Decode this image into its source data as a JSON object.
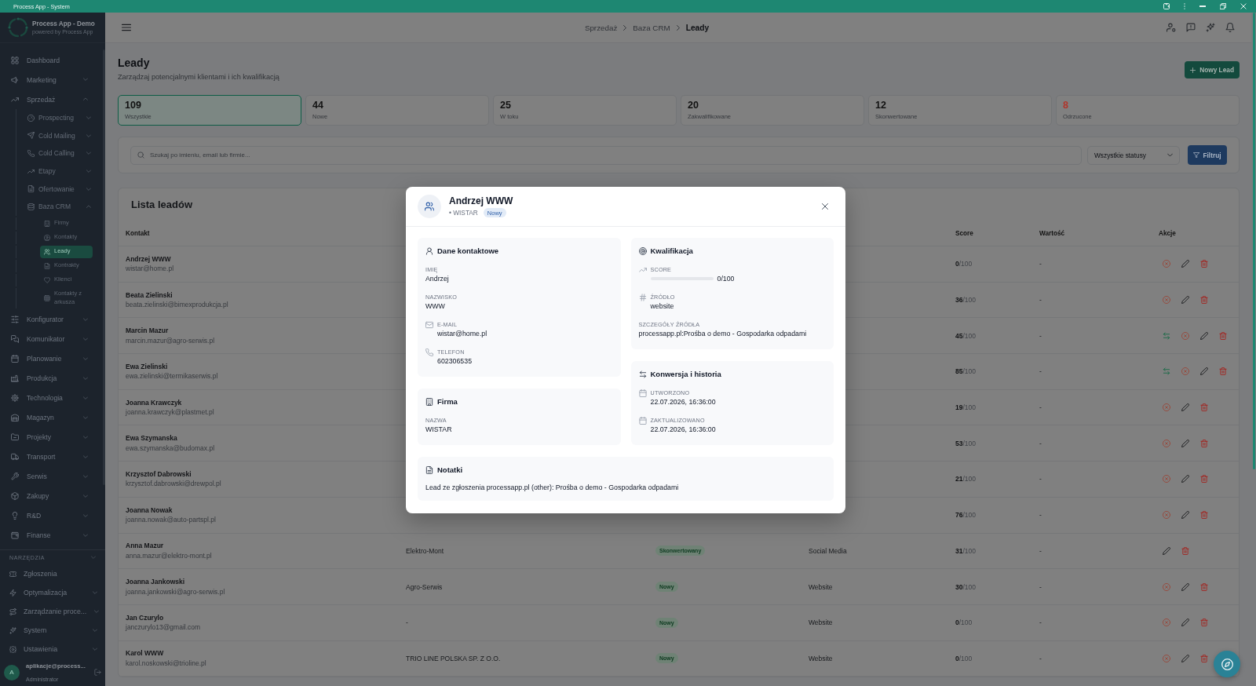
{
  "window": {
    "title": "Process App - System"
  },
  "sidebar": {
    "app_name": "Process App - Demo",
    "tagline": "powered by Process App",
    "items": [
      {
        "label": "Dashboard",
        "kind": "link",
        "selected": false
      },
      {
        "label": "Marketing",
        "kind": "group",
        "expanded": false,
        "selected": false
      },
      {
        "label": "Sprzedaż",
        "kind": "group",
        "expanded": true,
        "selected": false,
        "children": [
          {
            "label": "Prospecting",
            "kind": "group",
            "expanded": false,
            "selected": false
          },
          {
            "label": "Cold Mailing",
            "kind": "group",
            "expanded": false,
            "selected": false
          },
          {
            "label": "Cold Calling",
            "kind": "group",
            "expanded": false,
            "selected": false
          },
          {
            "label": "Etapy",
            "kind": "group",
            "expanded": false,
            "selected": false
          },
          {
            "label": "Ofertowanie",
            "kind": "group",
            "expanded": false,
            "selected": false
          },
          {
            "label": "Baza CRM",
            "kind": "group",
            "expanded": true,
            "selected": false,
            "children": [
              {
                "label": "Firmy",
                "kind": "link",
                "selected": false
              },
              {
                "label": "Kontakty",
                "kind": "link",
                "selected": false
              },
              {
                "label": "Leady",
                "kind": "link",
                "selected": true
              },
              {
                "label": "Kontrakty",
                "kind": "link",
                "selected": false
              },
              {
                "label": "Klienci",
                "kind": "link",
                "selected": false
              },
              {
                "label": "Kontakty z arkusza",
                "kind": "link",
                "selected": false
              }
            ]
          }
        ]
      },
      {
        "label": "Konfigurator",
        "kind": "group",
        "expanded": false,
        "selected": false
      },
      {
        "label": "Komunikator",
        "kind": "group",
        "expanded": false,
        "selected": false
      },
      {
        "label": "Planowanie",
        "kind": "group",
        "expanded": false,
        "selected": false
      },
      {
        "label": "Produkcja",
        "kind": "group",
        "expanded": false,
        "selected": false
      },
      {
        "label": "Technologia",
        "kind": "group",
        "expanded": false,
        "selected": false
      },
      {
        "label": "Magazyn",
        "kind": "group",
        "expanded": false,
        "selected": false
      },
      {
        "label": "Projekty",
        "kind": "group",
        "expanded": false,
        "selected": false
      },
      {
        "label": "Transport",
        "kind": "group",
        "expanded": false,
        "selected": false
      },
      {
        "label": "Serwis",
        "kind": "group",
        "expanded": false,
        "selected": false
      },
      {
        "label": "Zakupy",
        "kind": "group",
        "expanded": false,
        "selected": false
      },
      {
        "label": "R&D",
        "kind": "group",
        "expanded": false,
        "selected": false
      },
      {
        "label": "Finanse",
        "kind": "group",
        "expanded": false,
        "selected": false
      }
    ],
    "tools": {
      "label": "NARZĘDZIA",
      "expanded": true,
      "items": [
        {
          "label": "Zgłoszenia",
          "kind": "link",
          "selected": false
        },
        {
          "label": "Optymalizacja",
          "kind": "group",
          "expanded": false,
          "selected": false
        },
        {
          "label": "Zarządzanie proce...",
          "kind": "group",
          "expanded": false,
          "selected": false
        },
        {
          "label": "System",
          "kind": "group",
          "expanded": false,
          "selected": false
        },
        {
          "label": "Ustawienia",
          "kind": "group",
          "expanded": false,
          "selected": false
        }
      ]
    },
    "user": {
      "initial": "A",
      "name": "aplikacje@process...",
      "role": "Administrator"
    }
  },
  "topbar": {
    "breadcrumb": [
      "Sprzedaż",
      "Baza CRM",
      "Leady"
    ]
  },
  "page": {
    "title": "Leady",
    "subtitle": "Zarządzaj potencjalnymi klientami i ich kwalifikacją",
    "new_button": "Nowy Lead"
  },
  "stats": [
    {
      "value": "109",
      "label": "Wszystkie",
      "selected": true,
      "color": "#111111"
    },
    {
      "value": "44",
      "label": "Nowe",
      "selected": false,
      "color": "#111111"
    },
    {
      "value": "25",
      "label": "W toku",
      "selected": false,
      "color": "#111111"
    },
    {
      "value": "20",
      "label": "Zakwalifikowane",
      "selected": false,
      "color": "#111111"
    },
    {
      "value": "12",
      "label": "Skonwertowane",
      "selected": false,
      "color": "#111111"
    },
    {
      "value": "8",
      "label": "Odrzucone",
      "selected": false,
      "color": "#b0352b"
    }
  ],
  "filters": {
    "search": {
      "placeholder": "Szukaj po imieniu, email lub firmie..."
    },
    "status_select": {
      "value": "Wszystkie statusy"
    },
    "button": "Filtruj"
  },
  "leads_table": {
    "title": "Lista leadów",
    "columns": {
      "contact": "Kontakt",
      "score": "Score",
      "value": "Wartość",
      "actions": "Akcje"
    },
    "rows": [
      {
        "name": "Andrzej WWW",
        "email": "wistar@home.pl",
        "score": "**0**/100",
        "value": "-",
        "actions": [
          {
            "kind": "reject"
          },
          {
            "kind": "edit"
          },
          {
            "kind": "delete"
          }
        ]
      },
      {
        "name": "Beata Zielinski",
        "email": "beata.zielinski@bimexprodukcja.pl",
        "score": "**36**/100",
        "value": "-",
        "actions": [
          {
            "kind": "reject"
          },
          {
            "kind": "edit"
          },
          {
            "kind": "delete"
          }
        ]
      },
      {
        "name": "Marcin Mazur",
        "email": "marcin.mazur@agro-serwis.pl",
        "score": "**45**/100",
        "value": "-",
        "actions": [
          {
            "kind": "convert"
          },
          {
            "kind": "reject"
          },
          {
            "kind": "edit"
          },
          {
            "kind": "delete"
          }
        ]
      },
      {
        "name": "Ewa Zielinski",
        "email": "ewa.zielinski@termikaserwis.pl",
        "score": "**85**/100",
        "value": "-",
        "actions": [
          {
            "kind": "convert"
          },
          {
            "kind": "reject"
          },
          {
            "kind": "edit"
          },
          {
            "kind": "delete"
          }
        ]
      },
      {
        "name": "Joanna Krawczyk",
        "email": "joanna.krawczyk@plastmet.pl",
        "score": "**19**/100",
        "value": "-",
        "actions": [
          {
            "kind": "reject"
          },
          {
            "kind": "edit"
          },
          {
            "kind": "delete"
          }
        ]
      },
      {
        "name": "Ewa Szymanska",
        "email": "ewa.szymanska@budomax.pl",
        "score": "**53**/100",
        "value": "-",
        "actions": [
          {
            "kind": "reject"
          },
          {
            "kind": "edit"
          },
          {
            "kind": "delete"
          }
        ]
      },
      {
        "name": "Krzysztof Dabrowski",
        "email": "krzysztof.dabrowski@drewpol.pl",
        "score": "**21**/100",
        "value": "-",
        "actions": [
          {
            "kind": "reject"
          },
          {
            "kind": "edit"
          },
          {
            "kind": "delete"
          }
        ]
      },
      {
        "name": "Joanna Nowak",
        "email": "joanna.nowak@auto-partspl.pl",
        "score": "**76**/100",
        "value": "-",
        "actions": [
          {
            "kind": "reject"
          },
          {
            "kind": "edit"
          },
          {
            "kind": "delete"
          }
        ]
      },
      {
        "name": "Anna Mazur",
        "email": "anna.mazur@elektro-mont.pl",
        "company": "Elektro-Mont",
        "status": "Skonwertowany",
        "source": "Social Media",
        "score": "**31**/100",
        "value": "-",
        "actions": [
          {
            "kind": "edit"
          },
          {
            "kind": "delete"
          }
        ]
      },
      {
        "name": "Joanna Jankowski",
        "email": "joanna.jankowski@agro-serwis.pl",
        "company": "Agro-Serwis",
        "status": "Nowy",
        "source": "Website",
        "score": "**30**/100",
        "value": "-",
        "actions": [
          {
            "kind": "reject"
          },
          {
            "kind": "edit"
          },
          {
            "kind": "delete"
          }
        ]
      },
      {
        "name": "Jan Czurylo",
        "email": "janczurylo13@gmail.com",
        "company": "-",
        "status": "Nowy",
        "source": "Website",
        "score": "**0**/100",
        "value": "-",
        "actions": [
          {
            "kind": "reject"
          },
          {
            "kind": "edit"
          },
          {
            "kind": "delete"
          }
        ]
      },
      {
        "name": "Karol WWW",
        "email": "karol.noskowski@trioline.pl",
        "company": "TRIO LINE POLSKA SP. Z O.O.",
        "status": "Nowy",
        "source": "Website",
        "score": "**0**/100",
        "value": "-",
        "actions": [
          {
            "kind": "reject"
          },
          {
            "kind": "edit"
          },
          {
            "kind": "delete"
          }
        ]
      }
    ]
  },
  "lead_dialog": {
    "title": "Andrzej WWW",
    "subtitle": "• WISTAR",
    "status": "Nowy",
    "columns": [
      {
        "sections": [
          {
            "title": "Dane kontaktowe",
            "fields": [
              {
                "kind": "plain",
                "label": "IMIĘ",
                "value": "Andrzej"
              },
              {
                "kind": "plain",
                "label": "NAZWISKO",
                "value": "WWW"
              },
              {
                "kind": "email",
                "label": "E-MAIL",
                "value": "wistar@home.pl"
              },
              {
                "kind": "phone",
                "label": "TELEFON",
                "value": "602306535"
              }
            ]
          },
          {
            "title": "Firma",
            "fields": [
              {
                "kind": "plain",
                "label": "NAZWA",
                "value": "WISTAR"
              }
            ]
          }
        ]
      },
      {
        "sections": [
          {
            "title": "Kwalifikacja",
            "fields": [
              {
                "kind": "score",
                "label": "SCORE",
                "level": 0,
                "value": "0/100"
              },
              {
                "kind": "source",
                "label": "ŹRÓDŁO",
                "value": "website"
              },
              {
                "kind": "plain",
                "label": "SZCZEGÓŁY ŹRÓDŁA",
                "value": "processapp.pl:Prośba o demo - Gospodarka odpadami"
              }
            ]
          },
          {
            "title": "Konwersja i historia",
            "fields": [
              {
                "kind": "date",
                "label": "UTWORZONO",
                "value": "22.07.2026, 16:36:00"
              },
              {
                "kind": "date",
                "label": "ZAKTUALIZOWANO",
                "value": "22.07.2026, 16:36:00"
              }
            ]
          }
        ]
      }
    ],
    "notes": {
      "title": "Notatki",
      "text": "Lead ze zgłoszenia processapp.pl (other): Prośba o demo - Gospodarka odpadami"
    }
  }
}
